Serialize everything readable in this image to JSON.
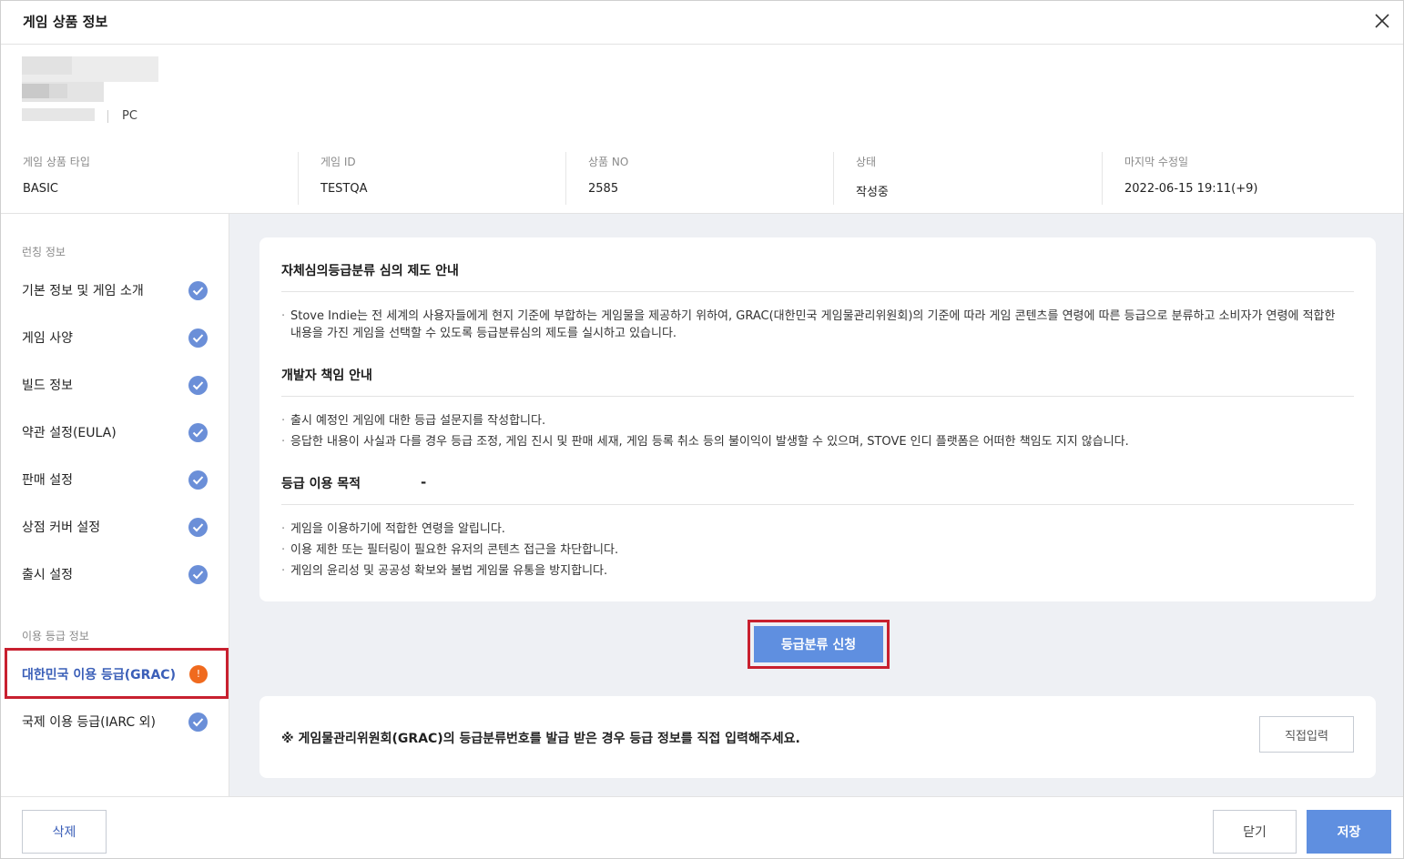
{
  "modal": {
    "title": "게임 상품 정보"
  },
  "product": {
    "platform": "PC",
    "meta": [
      {
        "label": "게임 상품 타입",
        "value": "BASIC"
      },
      {
        "label": "게임 ID",
        "value": "TESTQA"
      },
      {
        "label": "상품 NO",
        "value": "2585"
      },
      {
        "label": "상태",
        "value": "작성중"
      },
      {
        "label": "마지막 수정일",
        "value": "2022-06-15 19:11(+9)"
      }
    ]
  },
  "sidebar": {
    "launch_section": "런칭 정보",
    "launch_items": [
      {
        "label": "기본 정보 및 게임 소개",
        "status": "complete"
      },
      {
        "label": "게임 사양",
        "status": "complete"
      },
      {
        "label": "빌드 정보",
        "status": "complete"
      },
      {
        "label": "약관 설정(EULA)",
        "status": "complete"
      },
      {
        "label": "판매 설정",
        "status": "complete"
      },
      {
        "label": "상점 커버 설정",
        "status": "complete"
      },
      {
        "label": "출시 설정",
        "status": "complete"
      }
    ],
    "rating_section": "이용 등급 정보",
    "rating_items": [
      {
        "label": "대한민국 이용 등급(GRAC)",
        "status": "warning",
        "badge": "!"
      },
      {
        "label": "국제 이용 등급(IARC 외)",
        "status": "complete"
      }
    ]
  },
  "main": {
    "info_card": {
      "section1_title": "자체심의등급분류 심의 제도 안내",
      "section1_bullets": [
        "Stove Indie는 전 세계의 사용자들에게 현지 기준에 부합하는 게임물을 제공하기 위하여, GRAC(대한민국 게임물관리위원회)의 기준에 따라 게임 콘텐츠를 연령에 따른 등급으로 분류하고 소비자가 연령에 적합한 내용을 가진 게임을 선택할 수 있도록 등급분류심의 제도를 실시하고 있습니다."
      ],
      "section2_title": "개발자 책임 안내",
      "section2_bullets": [
        "출시 예정인 게임에 대한 등급 설문지를 작성합니다.",
        "응답한 내용이 사실과 다를 경우 등급 조정, 게임 진시 및 판매 세재, 게임 등록 취소 등의 불이익이 발생할 수 있으며, STOVE 인디 플랫폼은 어떠한 책임도 지지 않습니다."
      ],
      "section3_title": "등급 이용 목적",
      "section3_dash": "-",
      "section3_bullets": [
        "게임을 이용하기에 적합한 연령을 알립니다.",
        "이용 제한 또는 필터링이 필요한 유저의 콘텐츠 접근을 차단합니다.",
        "게임의 윤리성 및 공공성 확보와 불법 게임물 유통을 방지합니다."
      ]
    },
    "apply_button": "등급분류 신청",
    "notice_card": {
      "text": "※ 게임물관리위원회(GRAC)의 등급분류번호를 발급 받은 경우 등급 정보를 직접 입력해주세요.",
      "button": "직접입력"
    }
  },
  "footer": {
    "delete": "삭제",
    "close": "닫기",
    "save": "저장"
  },
  "colors": {
    "accent": "#5f8fe0",
    "check": "#6b8fd8",
    "warning": "#f06a1e",
    "highlight_frame": "#c8202f",
    "main_bg": "#eef0f4"
  }
}
